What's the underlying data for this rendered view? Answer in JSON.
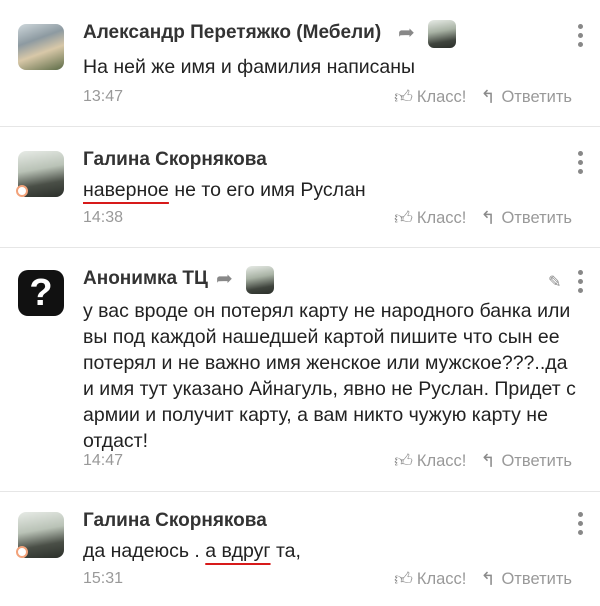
{
  "comments": [
    {
      "author": "Александр Перетяжко (Мебели)",
      "text": "На ней же имя и фамилия написаны",
      "time": "13:47"
    },
    {
      "author": "Галина Скорнякова",
      "text_before": "наверное",
      "text_after": " не то его имя Руслан",
      "time": "14:38"
    },
    {
      "author": "Анонимка ТЦ",
      "avatar_glyph": "?",
      "text": "у вас вроде он потерял карту не народного банка или вы под каждой нашедшей картой пишите что сын ее потерял и не важно имя женское или мужское???..да и имя тут указано Айнагуль, явно не Руслан. Придет с армии и получит карту, а вам никто чужую карту не отдаст!",
      "time": "14:47"
    },
    {
      "author": "Галина Скорнякова",
      "text_before": "да надеюсь . ",
      "text_underlined": "а вдруг",
      "text_after": " та,",
      "time": "15:31"
    }
  ],
  "actions": {
    "like_label": "Класс!",
    "reply_label": "Ответить"
  },
  "icons": {
    "like": "thumbs-up-icon",
    "reply": "reply-arrow-icon",
    "menu": "more-vertical-icon",
    "edit": "pencil-icon",
    "reply_to": "forward-arrow-icon"
  },
  "colors": {
    "underline": "#d71a1a",
    "meta_text": "#999999",
    "online_ring": "#f2a27a"
  }
}
